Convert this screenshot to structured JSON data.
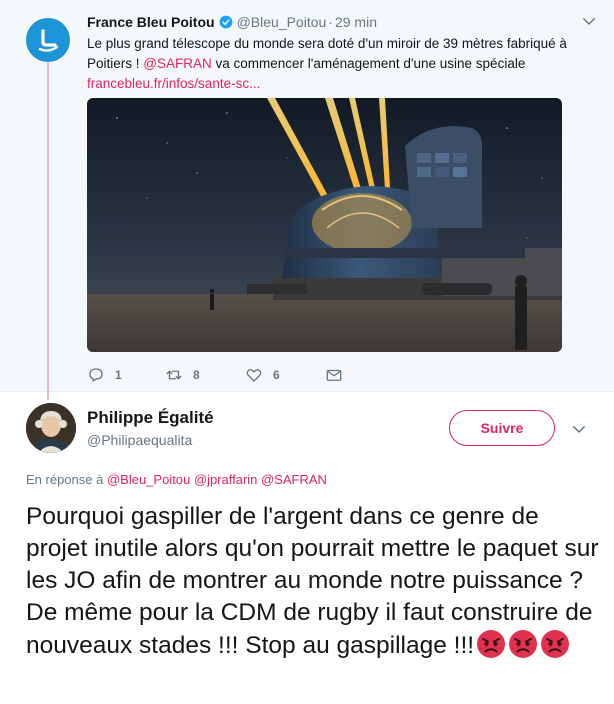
{
  "parent_tweet": {
    "author_name": "France Bleu Poitou",
    "author_handle": "@Bleu_Poitou",
    "separator": "·",
    "time": "29 min",
    "text_part1": "Le plus grand télescope du monde sera doté d'un miroir de 39 mètres fabriqué à Poitiers ! ",
    "mention": "@SAFRAN",
    "text_part2": " va commencer l'aménagement d'une usine spéciale",
    "link": "francebleu.fr/infos/sante-sc...",
    "reply_count": "1",
    "retweet_count": "8",
    "like_count": "6"
  },
  "main_tweet": {
    "author_name": "Philippe Égalité",
    "author_handle": "@Philipaequalita",
    "follow_label": "Suivre",
    "reply_prefix": "En réponse à ",
    "reply_mentions": "@Bleu_Poitou @jpraffarin @SAFRAN",
    "text": "Pourquoi gaspiller de l'argent dans ce genre de projet inutile alors qu'on pourrait mettre le paquet sur les JO afin de montrer au monde notre puissance ? De même pour la CDM de rugby il faut construire de nouveaux stades !!! Stop au gaspillage !!!",
    "emojis": [
      "angry-face-icon",
      "angry-face-icon",
      "angry-face-icon"
    ]
  },
  "colors": {
    "accent": "#e0245e",
    "muted": "#657786",
    "text": "#14171a",
    "verified": "#1da1f2",
    "thread_line": "#e8b6ca",
    "parent_bg": "#f5f8fa"
  }
}
